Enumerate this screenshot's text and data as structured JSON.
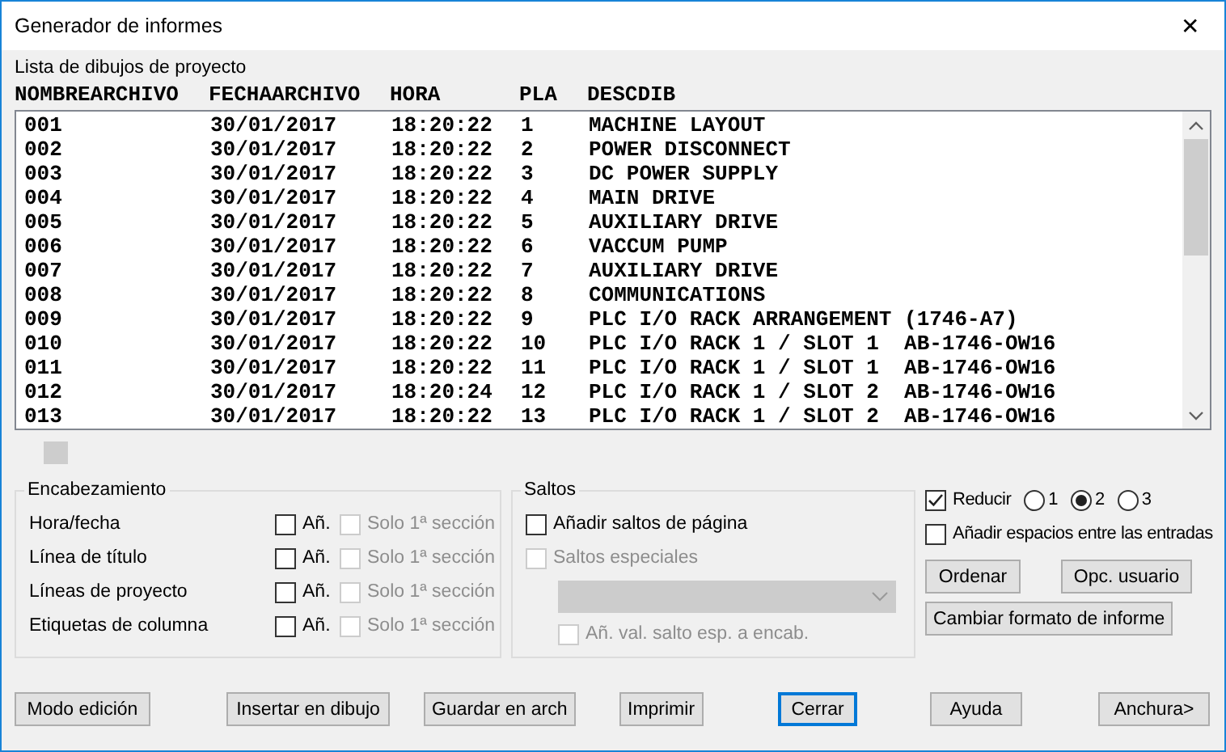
{
  "window": {
    "title": "Generador de informes",
    "close": "✕"
  },
  "list": {
    "label": "Lista de dibujos de proyecto",
    "columns": [
      "NOMBREARCHIVO",
      "FECHAARCHIVO",
      "HORA",
      "PLA",
      "DESCDIB"
    ],
    "rows": [
      [
        "001",
        "30/01/2017",
        "18:20:22",
        "1",
        "MACHINE LAYOUT"
      ],
      [
        "002",
        "30/01/2017",
        "18:20:22",
        "2",
        "POWER DISCONNECT"
      ],
      [
        "003",
        "30/01/2017",
        "18:20:22",
        "3",
        "DC POWER SUPPLY"
      ],
      [
        "004",
        "30/01/2017",
        "18:20:22",
        "4",
        "MAIN DRIVE"
      ],
      [
        "005",
        "30/01/2017",
        "18:20:22",
        "5",
        "AUXILIARY DRIVE"
      ],
      [
        "006",
        "30/01/2017",
        "18:20:22",
        "6",
        "VACCUM PUMP"
      ],
      [
        "007",
        "30/01/2017",
        "18:20:22",
        "7",
        "AUXILIARY DRIVE"
      ],
      [
        "008",
        "30/01/2017",
        "18:20:22",
        "8",
        "COMMUNICATIONS"
      ],
      [
        "009",
        "30/01/2017",
        "18:20:22",
        "9",
        "PLC I/O RACK ARRANGEMENT (1746-A7)"
      ],
      [
        "010",
        "30/01/2017",
        "18:20:22",
        "10",
        "PLC I/O RACK 1 / SLOT 1  AB-1746-OW16"
      ],
      [
        "011",
        "30/01/2017",
        "18:20:22",
        "11",
        "PLC I/O RACK 1 / SLOT 1  AB-1746-OW16"
      ],
      [
        "012",
        "30/01/2017",
        "18:20:24",
        "12",
        "PLC I/O RACK 1 / SLOT 2  AB-1746-OW16"
      ],
      [
        "013",
        "30/01/2017",
        "18:20:22",
        "13",
        "PLC I/O RACK 1 / SLOT 2  AB-1746-OW16"
      ]
    ]
  },
  "encabezamiento": {
    "title": "Encabezamiento",
    "rows": [
      {
        "label": "Hora/fecha",
        "add": {
          "label": "Añ.",
          "checked": false,
          "disabled": false
        },
        "first_only": {
          "label": "Solo 1ª sección",
          "checked": false,
          "disabled": true
        }
      },
      {
        "label": "Línea de título",
        "add": {
          "label": "Añ.",
          "checked": false,
          "disabled": false
        },
        "first_only": {
          "label": "Solo 1ª sección",
          "checked": false,
          "disabled": true
        }
      },
      {
        "label": "Líneas de proyecto",
        "add": {
          "label": "Añ.",
          "checked": false,
          "disabled": false
        },
        "first_only": {
          "label": "Solo 1ª sección",
          "checked": false,
          "disabled": true
        }
      },
      {
        "label": "Etiquetas de columna",
        "add": {
          "label": "Añ.",
          "checked": false,
          "disabled": false
        },
        "first_only": {
          "label": "Solo 1ª sección",
          "checked": false,
          "disabled": true
        }
      }
    ]
  },
  "saltos": {
    "title": "Saltos",
    "page_breaks": {
      "label": "Añadir saltos de página",
      "checked": false,
      "disabled": false
    },
    "special": {
      "label": "Saltos especiales",
      "checked": false,
      "disabled": true
    },
    "dropdown": {
      "disabled": true
    },
    "add_value": {
      "label": "Añ. val. salto esp. a encab.",
      "checked": false,
      "disabled": true
    }
  },
  "reduce": {
    "label": "Reducir",
    "checked": true,
    "disabled": false
  },
  "radios": [
    {
      "label": "1",
      "selected": false
    },
    {
      "label": "2",
      "selected": true
    },
    {
      "label": "3",
      "selected": false
    }
  ],
  "spacing": {
    "label": "Añadir espacios entre las entradas",
    "checked": false,
    "disabled": false
  },
  "side_buttons": [
    {
      "label": "Ordenar"
    },
    {
      "label": "Opc. usuario"
    },
    {
      "label": "Cambiar formato de informe"
    }
  ],
  "footer_buttons": [
    {
      "label": "Modo edición",
      "focused": false
    },
    {
      "label": "Insertar en dibujo",
      "focused": false
    },
    {
      "label": "Guardar en arch",
      "focused": false
    },
    {
      "label": "Imprimir",
      "focused": false
    },
    {
      "label": "Cerrar",
      "focused": true
    },
    {
      "label": "Ayuda",
      "focused": false
    },
    {
      "label": "Anchura>",
      "focused": false
    }
  ]
}
